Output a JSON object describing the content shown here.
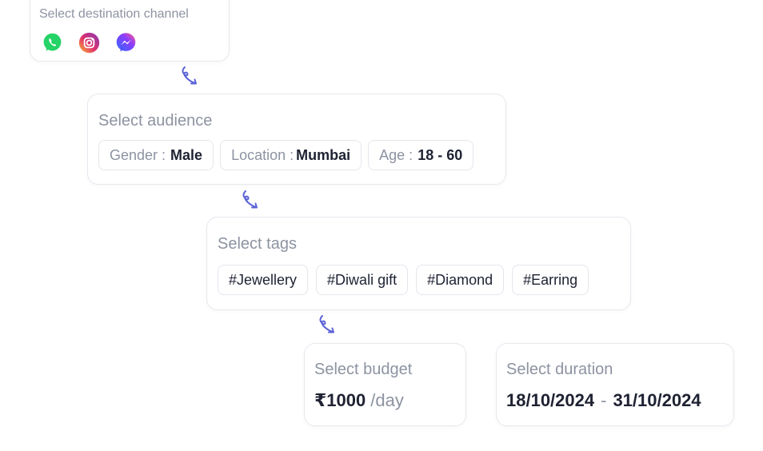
{
  "destination": {
    "title": "Select destination channel",
    "channels": [
      {
        "icon": "whatsapp-icon",
        "color": "#25D366"
      },
      {
        "icon": "instagram-icon",
        "color": "#E1306C"
      },
      {
        "icon": "messenger-icon",
        "color": "#5B5BF0"
      }
    ]
  },
  "audience": {
    "title": "Select audience",
    "gender": {
      "label": "Gender :",
      "value": "Male"
    },
    "location": {
      "label": "Location :",
      "value": "Mumbai"
    },
    "age": {
      "label": "Age :",
      "value": "18 - 60"
    }
  },
  "tags": {
    "title": "Select tags",
    "items": [
      "#Jewellery",
      "#Diwali gift",
      "#Diamond",
      "#Earring"
    ]
  },
  "budget": {
    "title": "Select budget",
    "amount": "₹1000",
    "unit": "/day"
  },
  "duration": {
    "title": "Select duration",
    "start": "18/10/2024",
    "separator": "-",
    "end": "31/10/2024"
  },
  "colors": {
    "connector": "#5B63D6",
    "muted_text": "#8d93a1",
    "strong_text": "#1e2232",
    "border": "#e6e8ee"
  }
}
